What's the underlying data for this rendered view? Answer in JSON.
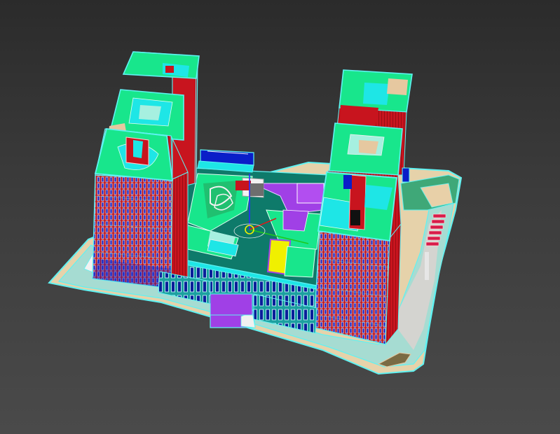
{
  "viewport": {
    "background_color": "#3f3f3f",
    "selection_outline_color": "#5ff2f2"
  },
  "model": {
    "wire_color_palette": [
      "#c8141e",
      "#18e68c",
      "#1ee6e6",
      "#a0f0e6",
      "#0a1ec8",
      "#a040e6",
      "#f0f000",
      "#e6c8a0",
      "#3ca078",
      "#6e8cf0"
    ]
  }
}
